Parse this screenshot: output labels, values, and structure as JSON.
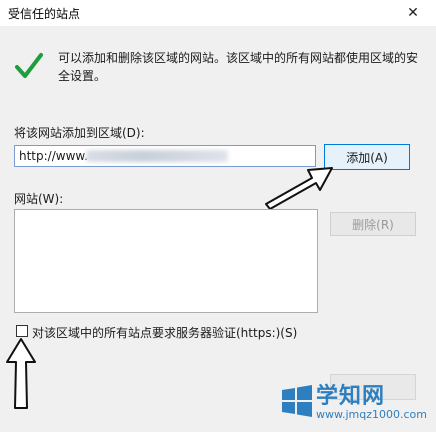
{
  "dialog": {
    "title": "受信任的站点",
    "close_glyph": "✕",
    "info_text": "可以添加和删除该区域的网站。该区域中的所有网站都使用区域的安全设置。",
    "add_label": "将该网站添加到区域(D):",
    "url_value": "http://www.",
    "add_button": "添加(A)",
    "websites_label": "网站(W):",
    "remove_button": "删除(R)",
    "https_checkbox_label": "对该区域中的所有站点要求服务器验证(https:)(S)",
    "https_checked": false
  },
  "icons": {
    "check": "checkmark-icon",
    "close": "close-icon",
    "arrow_add": "arrow-pointer-icon",
    "arrow_checkbox": "arrow-up-icon"
  },
  "colors": {
    "check_green": "#1e9e3e",
    "accent": "#0078d7",
    "watermark": "#2e7fc0"
  },
  "watermark": {
    "name": "学知网",
    "url": "www.jmqz1000.com"
  }
}
